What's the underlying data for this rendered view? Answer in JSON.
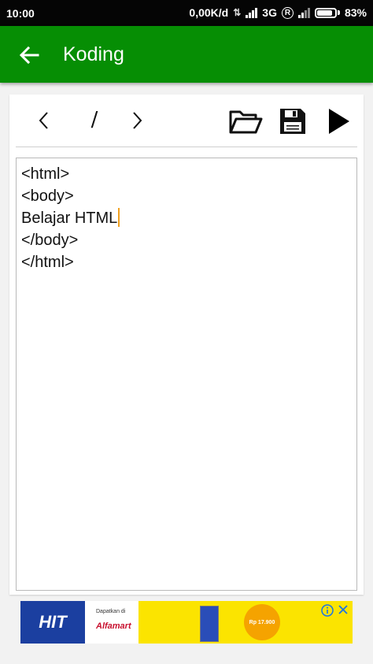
{
  "status_bar": {
    "time": "10:00",
    "network_speed": "0,00K/d",
    "network_type": "3G",
    "roaming": "R",
    "battery": "83%"
  },
  "app_bar": {
    "title": "Koding",
    "back_icon": "arrow-left-icon",
    "color": "#068e04"
  },
  "toolbar": {
    "undo_icon": "chevron-left-icon",
    "slash": "/",
    "redo_icon": "chevron-right-icon",
    "open_icon": "folder-open-icon",
    "save_icon": "save-icon",
    "run_icon": "play-icon"
  },
  "editor": {
    "lines": [
      "<html>",
      "<body>",
      "Belajar HTML",
      "</body>",
      "</html>"
    ]
  },
  "ad": {
    "logo": "HIT",
    "tagline": "Dapatkan di",
    "store": "Alfamart",
    "price": "Rp 17.900"
  }
}
